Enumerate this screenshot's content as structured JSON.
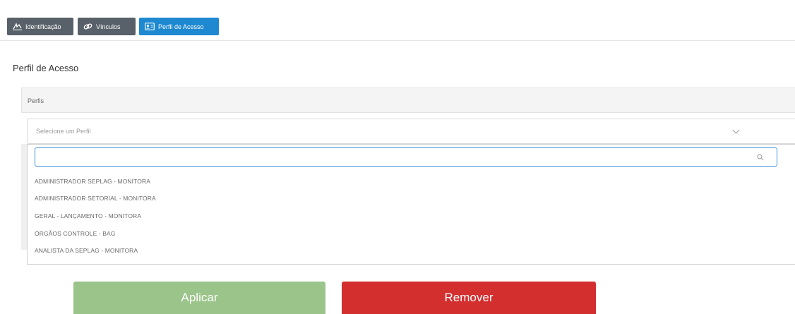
{
  "tabs": [
    {
      "label": "Identificação",
      "icon": "signature-icon",
      "active": false
    },
    {
      "label": "Vínculos",
      "icon": "link-icon",
      "active": false
    },
    {
      "label": "Perfil de Acesso",
      "icon": "id-card-icon",
      "active": true
    }
  ],
  "section_title": "Perfil de Acesso",
  "panel": {
    "label": "Perfis"
  },
  "select": {
    "placeholder": "Selecione um Perfil"
  },
  "search": {
    "value": "",
    "placeholder": ""
  },
  "options": [
    "ADMINISTRADOR SEPLAG - MONITORA",
    "ADMINISTRADOR SETORIAL - MONITORA",
    "GERAL - LANÇAMENTO - MONITORA",
    "ÓRGÃOS CONTROLE - BAG",
    "ANALISTA DA SEPLAG - MONITORA"
  ],
  "buttons": {
    "apply": "Aplicar",
    "remove": "Remover"
  },
  "colors": {
    "tab_active": "#1e88d0",
    "tab_inactive": "#586069",
    "apply": "#9bc48b",
    "remove": "#d32f2f"
  }
}
